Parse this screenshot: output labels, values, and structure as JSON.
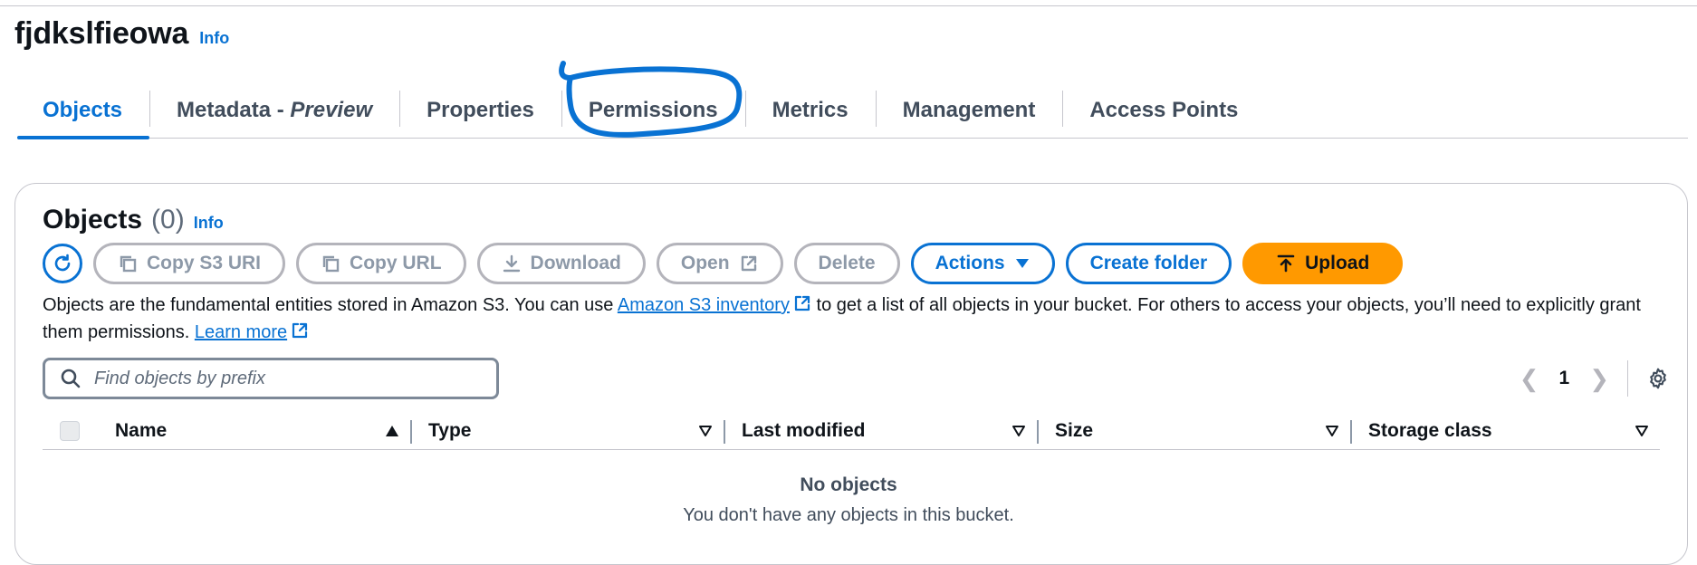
{
  "bucket": {
    "name": "fjdkslfieowa",
    "info_label": "Info"
  },
  "tabs": [
    {
      "label": "Objects",
      "active": true
    },
    {
      "label": "Metadata - ",
      "suffix": "Preview"
    },
    {
      "label": "Properties"
    },
    {
      "label": "Permissions"
    },
    {
      "label": "Metrics"
    },
    {
      "label": "Management"
    },
    {
      "label": "Access Points"
    }
  ],
  "objects": {
    "title": "Objects",
    "count": "(0)",
    "info_label": "Info",
    "toolbar": {
      "refresh_icon": "refresh-icon",
      "copy_s3_uri": "Copy S3 URI",
      "copy_url": "Copy URL",
      "download": "Download",
      "open": "Open",
      "delete": "Delete",
      "actions": "Actions",
      "create_folder": "Create folder",
      "upload": "Upload"
    },
    "description": {
      "part1": "Objects are the fundamental entities stored in Amazon S3. You can use ",
      "inventory_link": "Amazon S3 inventory",
      "part2": " to get a list of all objects in your bucket. For others to access your objects, you’ll need to explicitly grant them permissions. ",
      "learn_more": "Learn more"
    },
    "search": {
      "placeholder": "Find objects by prefix",
      "value": ""
    },
    "pagination": {
      "current_page": "1"
    },
    "columns": [
      "Name",
      "Type",
      "Last modified",
      "Size",
      "Storage class"
    ],
    "empty": {
      "title": "No objects",
      "subtitle": "You don't have any objects in this bucket."
    }
  },
  "colors": {
    "accent": "#0972d3",
    "upload": "#ff9900",
    "annotation": "#0972d3"
  }
}
